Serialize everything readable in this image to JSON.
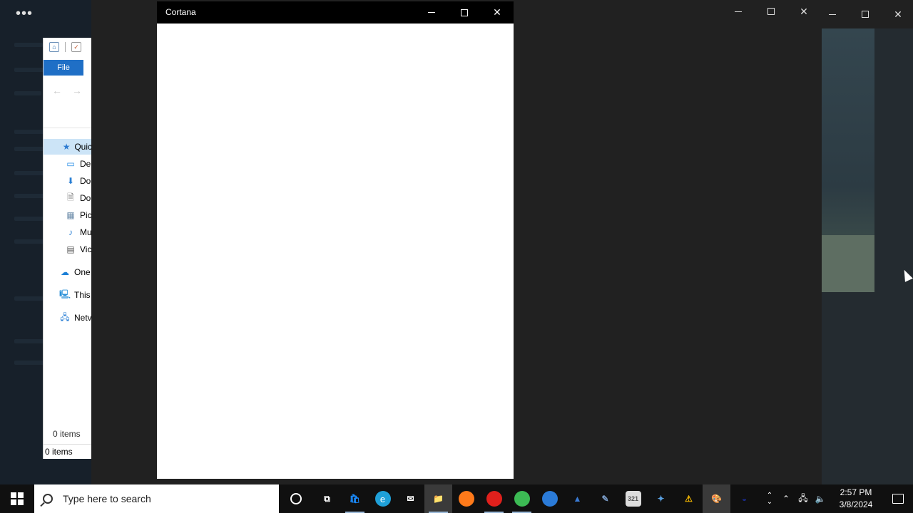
{
  "background_app": {
    "menu_dots": "•••"
  },
  "explorer": {
    "file_tab": "File",
    "back_arrow": "←",
    "forward_arrow": "→",
    "tree": [
      {
        "label": "Quic",
        "icon": "star-icon",
        "glyph": "★",
        "color": "#2f7bd1",
        "selected": true
      },
      {
        "label": "De",
        "icon": "desktop-icon",
        "glyph": "▭",
        "color": "#1e88e5"
      },
      {
        "label": "Do",
        "icon": "downloads-icon",
        "glyph": "⬇",
        "color": "#2a7fd4"
      },
      {
        "label": "Do",
        "icon": "documents-icon",
        "glyph": "🗎",
        "color": "#777"
      },
      {
        "label": "Pic",
        "icon": "pictures-icon",
        "glyph": "▦",
        "color": "#6a8aa8"
      },
      {
        "label": "Mu",
        "icon": "music-icon",
        "glyph": "♪",
        "color": "#2a7fd4"
      },
      {
        "label": "Vic",
        "icon": "videos-icon",
        "glyph": "▤",
        "color": "#555"
      },
      {
        "label": "One",
        "icon": "onedrive-icon",
        "glyph": "☁",
        "color": "#1b7fd6"
      },
      {
        "label": "This",
        "icon": "this-pc-icon",
        "glyph": "🖳",
        "color": "#2a90d8"
      },
      {
        "label": "Netv",
        "icon": "network-icon",
        "glyph": "🖧",
        "color": "#2a7fd4"
      }
    ],
    "status_items": "0 items",
    "status_bar": "0 items"
  },
  "cortana": {
    "title": "Cortana",
    "minimize": "–",
    "maximize": "",
    "close": "✕"
  },
  "bg_controls": {
    "close": "✕"
  },
  "taskbar": {
    "search_placeholder": "Type here to search",
    "apps": [
      {
        "name": "cortana-button",
        "kind": "circle"
      },
      {
        "name": "task-view-button",
        "glyph": "⧉",
        "color": "#ffffff"
      },
      {
        "name": "microsoft-store-icon",
        "glyph": "🛍",
        "color": "#1a8cff",
        "running": true
      },
      {
        "name": "edge-icon",
        "glyph": "e",
        "color": "#1fa0d8",
        "round": true
      },
      {
        "name": "mail-icon",
        "glyph": "✉",
        "color": "#ffffff"
      },
      {
        "name": "file-explorer-icon",
        "glyph": "📁",
        "color": "#f2c94c",
        "running": true,
        "active": true
      },
      {
        "name": "firefox-icon",
        "glyph": "",
        "color": "#ff7a1a",
        "round": true
      },
      {
        "name": "opera-icon",
        "glyph": "",
        "color": "#e0201c",
        "round": true,
        "running": true
      },
      {
        "name": "chrome-icon",
        "glyph": "",
        "color": "#3cba54",
        "round": true,
        "running": true
      },
      {
        "name": "thunderbird-icon",
        "glyph": "",
        "color": "#2b7bd8",
        "round": true
      },
      {
        "name": "app-blue-icon",
        "glyph": "▲",
        "color": "#3a7bd5"
      },
      {
        "name": "photo-editor-icon",
        "glyph": "✎",
        "color": "#7a9cc8"
      },
      {
        "name": "calendar-app-icon",
        "glyph": "321",
        "color": "#555555"
      },
      {
        "name": "tool-app-icon",
        "glyph": "✦",
        "color": "#5aa0e0"
      },
      {
        "name": "warning-app-icon",
        "glyph": "⚠",
        "color": "#f5b800"
      },
      {
        "name": "paint-app-icon",
        "glyph": "🎨",
        "color": "#e06a3a",
        "active": true
      },
      {
        "name": "media-app-icon",
        "glyph": "◒",
        "color": "#1a2a8a"
      }
    ],
    "tray_up": "⌃",
    "tray_network": "🖧",
    "tray_volume": "🔈",
    "time": "2:57 PM",
    "date": "3/8/2024"
  }
}
